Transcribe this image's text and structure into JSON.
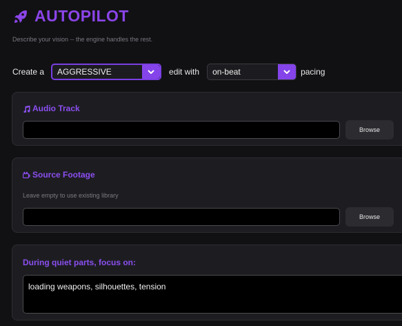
{
  "app": {
    "title": "AUTOPILOT",
    "subtitle": "Describe your vision -- the engine handles the rest.",
    "accent": "#8444ea"
  },
  "config": {
    "create_label": "Create a",
    "mode_value": "AGGRESSIVE",
    "edit_label": "edit with",
    "pacing_value": "on-beat",
    "pacing_label": "pacing"
  },
  "audio": {
    "title": "Audio Track",
    "icon": "music-note-icon",
    "value": "",
    "browse_label": "Browse"
  },
  "source": {
    "title": "Source Footage",
    "icon": "camera-icon",
    "hint": "Leave empty to use existing library",
    "value": "",
    "browse_label": "Browse"
  },
  "quiet": {
    "title": "During quiet parts, focus on:",
    "value": "loading weapons, silhouettes, tension"
  }
}
